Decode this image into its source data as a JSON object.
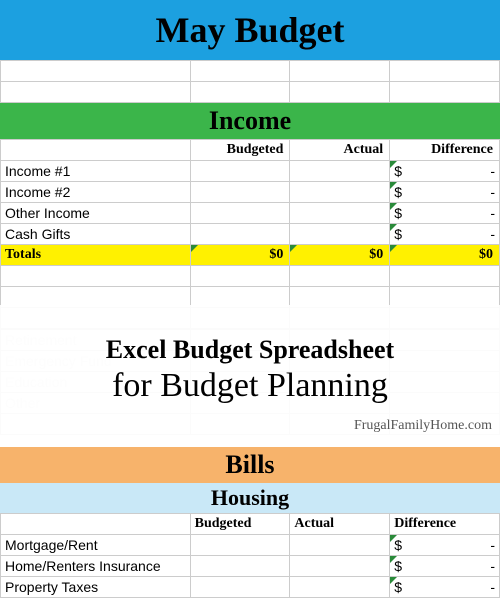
{
  "title": "May Budget",
  "income": {
    "heading": "Income",
    "columns": {
      "budgeted": "Budgeted",
      "actual": "Actual",
      "difference": "Difference"
    },
    "rows": [
      {
        "label": "Income #1",
        "diff_sym": "$",
        "diff_val": "-"
      },
      {
        "label": "Income #2",
        "diff_sym": "$",
        "diff_val": "-"
      },
      {
        "label": "Other Income",
        "diff_sym": "$",
        "diff_val": "-"
      },
      {
        "label": "Cash Gifts",
        "diff_sym": "$",
        "diff_val": "-"
      }
    ],
    "totals": {
      "label": "Totals",
      "budgeted": "$0",
      "actual": "$0",
      "difference": "$0"
    }
  },
  "faded_section": {
    "rows": [
      {
        "label": "Retinement"
      },
      {
        "label": "Emergency Fund"
      },
      {
        "label": "Education"
      },
      {
        "label": "Other"
      }
    ]
  },
  "overlay": {
    "line1": "Excel Budget Spreadsheet",
    "line2": "for Budget Planning"
  },
  "watermark": "FrugalFamilyHome.com",
  "bills": {
    "heading": "Bills",
    "subheading": "Housing",
    "columns": {
      "budgeted": "Budgeted",
      "actual": "Actual",
      "difference": "Difference"
    },
    "rows": [
      {
        "label": "Mortgage/Rent",
        "diff_sym": "$",
        "diff_val": "-"
      },
      {
        "label": "Home/Renters Insurance",
        "diff_sym": "$",
        "diff_val": "-"
      },
      {
        "label": "Property Taxes",
        "diff_sym": "$",
        "diff_val": "-"
      }
    ]
  }
}
